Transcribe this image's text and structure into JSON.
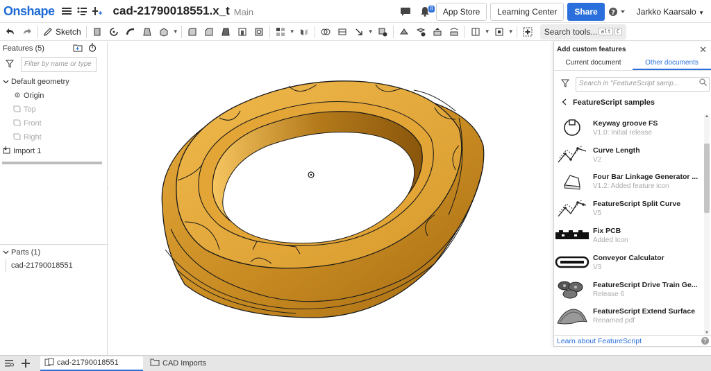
{
  "header": {
    "logo": "Onshape",
    "document_title": "cad-21790018551.x_t",
    "branch": "Main",
    "notification_count": "8",
    "app_store_label": "App Store",
    "learning_center_label": "Learning Center",
    "share_label": "Share",
    "user_name": "Jarkko Kaarsalo"
  },
  "toolbar": {
    "sketch_label": "Sketch",
    "search_tools_label": "Search tools...",
    "search_shortcut_alt": "alt",
    "search_shortcut_key": "C"
  },
  "feature_panel": {
    "title": "Features (5)",
    "filter_placeholder": "Filter by name or type",
    "default_geometry_label": "Default geometry",
    "items": [
      {
        "label": "Origin",
        "dim": false
      },
      {
        "label": "Top",
        "dim": true
      },
      {
        "label": "Front",
        "dim": true
      },
      {
        "label": "Right",
        "dim": true
      }
    ],
    "import_label": "Import 1",
    "parts_title": "Parts (1)",
    "part_name": "cad-21790018551"
  },
  "custom_features_dialog": {
    "title": "Add custom features",
    "tab_current": "Current document",
    "tab_other": "Other documents",
    "search_placeholder": "Search in \"FeatureScript samp...",
    "breadcrumb": "FeatureScript samples",
    "items": [
      {
        "name": "Keyway groove FS",
        "sub": "V1.0: Initial release",
        "icon": "keyway-groove-icon"
      },
      {
        "name": "Curve Length",
        "sub": "V2",
        "icon": "curve-length-icon"
      },
      {
        "name": "Four Bar Linkage Generator ...",
        "sub": "V1.2: Added feature icon",
        "icon": "linkage-icon"
      },
      {
        "name": "FeatureScript Split Curve",
        "sub": "V5",
        "icon": "split-curve-icon"
      },
      {
        "name": "Fix PCB",
        "sub": "Added Icon",
        "icon": "pcb-icon"
      },
      {
        "name": "Conveyor Calculator",
        "sub": "V3",
        "icon": "conveyor-icon"
      },
      {
        "name": "FeatureScript Drive Train Ge...",
        "sub": "Release 6",
        "icon": "drive-train-icon"
      },
      {
        "name": "FeatureScript Extend Surface",
        "sub": "Renamed pdf",
        "icon": "extend-surface-icon"
      }
    ],
    "footer_link": "Learn about FeatureScript"
  },
  "bottom_tabs": [
    {
      "label": "cad-21790018551",
      "active": true
    },
    {
      "label": "CAD Imports",
      "active": false
    }
  ],
  "colors": {
    "brand_blue": "#2a6fdb",
    "part_gold": "#d99a2b"
  }
}
